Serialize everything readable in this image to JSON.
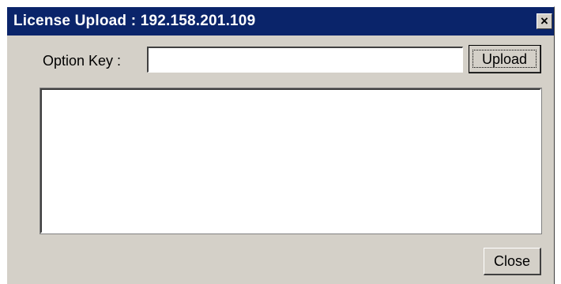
{
  "window": {
    "title": "License Upload : 192.158.201.109",
    "close_glyph": "×",
    "close_icon": "close-icon"
  },
  "form": {
    "option_key_label": "Option Key :",
    "option_key_value": "",
    "upload_label": "Upload"
  },
  "log": {
    "text": ""
  },
  "footer": {
    "close_label": "Close"
  },
  "colors": {
    "titlebar": "#0a246a",
    "face": "#d4d0c8",
    "field": "#ffffff"
  }
}
